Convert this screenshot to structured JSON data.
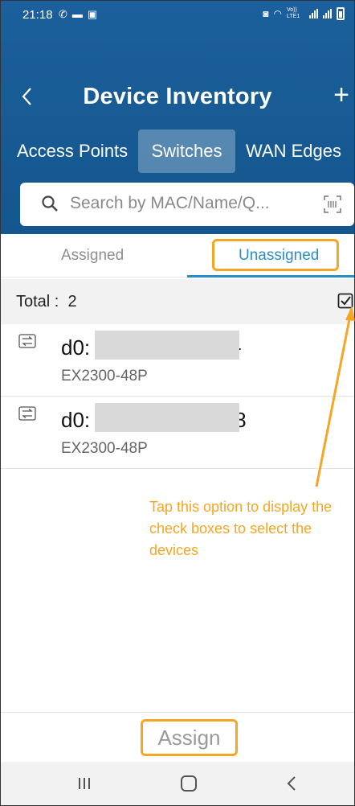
{
  "status_bar": {
    "time": "21:18",
    "volte": "Vo)) LTE1"
  },
  "header": {
    "title": "Device Inventory",
    "add_label": "+"
  },
  "segments": [
    "Access Points",
    "Switches",
    "WAN Edges"
  ],
  "search": {
    "placeholder": "Search by MAC/Name/Q..."
  },
  "tabs": {
    "assigned": "Assigned",
    "unassigned": "Unassigned"
  },
  "total": {
    "label": "Total :",
    "count": "2"
  },
  "devices": [
    {
      "mac_visible_start": "d0:",
      "mac_visible_end": "-",
      "model": "EX2300-48P"
    },
    {
      "mac_visible_start": "d0:",
      "mac_visible_end": "8",
      "model": "EX2300-48P"
    }
  ],
  "annotation": "Tap this option to display the check boxes to select the devices",
  "assign_label": "Assign",
  "colors": {
    "header": "#175a93",
    "accent": "#2a8fc9",
    "highlight": "#f5a623"
  }
}
